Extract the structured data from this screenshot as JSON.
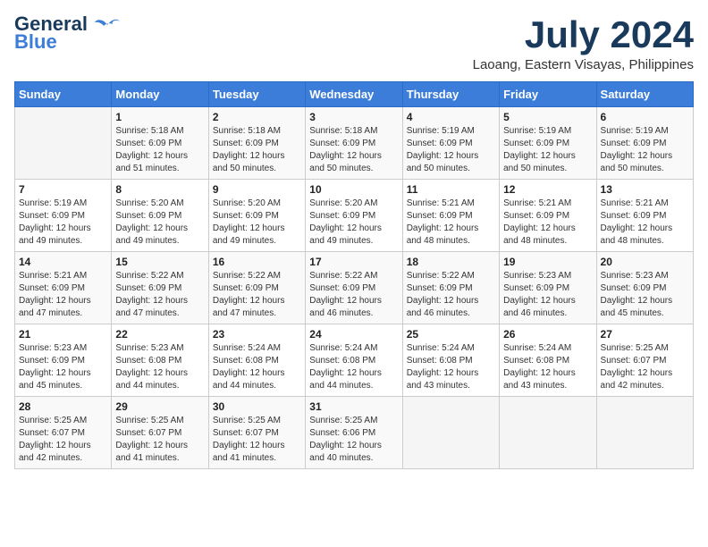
{
  "logo": {
    "line1": "General",
    "line2": "Blue"
  },
  "title": "July 2024",
  "location": "Laoang, Eastern Visayas, Philippines",
  "days_header": [
    "Sunday",
    "Monday",
    "Tuesday",
    "Wednesday",
    "Thursday",
    "Friday",
    "Saturday"
  ],
  "weeks": [
    [
      {
        "day": "",
        "info": ""
      },
      {
        "day": "1",
        "info": "Sunrise: 5:18 AM\nSunset: 6:09 PM\nDaylight: 12 hours\nand 51 minutes."
      },
      {
        "day": "2",
        "info": "Sunrise: 5:18 AM\nSunset: 6:09 PM\nDaylight: 12 hours\nand 50 minutes."
      },
      {
        "day": "3",
        "info": "Sunrise: 5:18 AM\nSunset: 6:09 PM\nDaylight: 12 hours\nand 50 minutes."
      },
      {
        "day": "4",
        "info": "Sunrise: 5:19 AM\nSunset: 6:09 PM\nDaylight: 12 hours\nand 50 minutes."
      },
      {
        "day": "5",
        "info": "Sunrise: 5:19 AM\nSunset: 6:09 PM\nDaylight: 12 hours\nand 50 minutes."
      },
      {
        "day": "6",
        "info": "Sunrise: 5:19 AM\nSunset: 6:09 PM\nDaylight: 12 hours\nand 50 minutes."
      }
    ],
    [
      {
        "day": "7",
        "info": "Sunrise: 5:19 AM\nSunset: 6:09 PM\nDaylight: 12 hours\nand 49 minutes."
      },
      {
        "day": "8",
        "info": "Sunrise: 5:20 AM\nSunset: 6:09 PM\nDaylight: 12 hours\nand 49 minutes."
      },
      {
        "day": "9",
        "info": "Sunrise: 5:20 AM\nSunset: 6:09 PM\nDaylight: 12 hours\nand 49 minutes."
      },
      {
        "day": "10",
        "info": "Sunrise: 5:20 AM\nSunset: 6:09 PM\nDaylight: 12 hours\nand 49 minutes."
      },
      {
        "day": "11",
        "info": "Sunrise: 5:21 AM\nSunset: 6:09 PM\nDaylight: 12 hours\nand 48 minutes."
      },
      {
        "day": "12",
        "info": "Sunrise: 5:21 AM\nSunset: 6:09 PM\nDaylight: 12 hours\nand 48 minutes."
      },
      {
        "day": "13",
        "info": "Sunrise: 5:21 AM\nSunset: 6:09 PM\nDaylight: 12 hours\nand 48 minutes."
      }
    ],
    [
      {
        "day": "14",
        "info": "Sunrise: 5:21 AM\nSunset: 6:09 PM\nDaylight: 12 hours\nand 47 minutes."
      },
      {
        "day": "15",
        "info": "Sunrise: 5:22 AM\nSunset: 6:09 PM\nDaylight: 12 hours\nand 47 minutes."
      },
      {
        "day": "16",
        "info": "Sunrise: 5:22 AM\nSunset: 6:09 PM\nDaylight: 12 hours\nand 47 minutes."
      },
      {
        "day": "17",
        "info": "Sunrise: 5:22 AM\nSunset: 6:09 PM\nDaylight: 12 hours\nand 46 minutes."
      },
      {
        "day": "18",
        "info": "Sunrise: 5:22 AM\nSunset: 6:09 PM\nDaylight: 12 hours\nand 46 minutes."
      },
      {
        "day": "19",
        "info": "Sunrise: 5:23 AM\nSunset: 6:09 PM\nDaylight: 12 hours\nand 46 minutes."
      },
      {
        "day": "20",
        "info": "Sunrise: 5:23 AM\nSunset: 6:09 PM\nDaylight: 12 hours\nand 45 minutes."
      }
    ],
    [
      {
        "day": "21",
        "info": "Sunrise: 5:23 AM\nSunset: 6:09 PM\nDaylight: 12 hours\nand 45 minutes."
      },
      {
        "day": "22",
        "info": "Sunrise: 5:23 AM\nSunset: 6:08 PM\nDaylight: 12 hours\nand 44 minutes."
      },
      {
        "day": "23",
        "info": "Sunrise: 5:24 AM\nSunset: 6:08 PM\nDaylight: 12 hours\nand 44 minutes."
      },
      {
        "day": "24",
        "info": "Sunrise: 5:24 AM\nSunset: 6:08 PM\nDaylight: 12 hours\nand 44 minutes."
      },
      {
        "day": "25",
        "info": "Sunrise: 5:24 AM\nSunset: 6:08 PM\nDaylight: 12 hours\nand 43 minutes."
      },
      {
        "day": "26",
        "info": "Sunrise: 5:24 AM\nSunset: 6:08 PM\nDaylight: 12 hours\nand 43 minutes."
      },
      {
        "day": "27",
        "info": "Sunrise: 5:25 AM\nSunset: 6:07 PM\nDaylight: 12 hours\nand 42 minutes."
      }
    ],
    [
      {
        "day": "28",
        "info": "Sunrise: 5:25 AM\nSunset: 6:07 PM\nDaylight: 12 hours\nand 42 minutes."
      },
      {
        "day": "29",
        "info": "Sunrise: 5:25 AM\nSunset: 6:07 PM\nDaylight: 12 hours\nand 41 minutes."
      },
      {
        "day": "30",
        "info": "Sunrise: 5:25 AM\nSunset: 6:07 PM\nDaylight: 12 hours\nand 41 minutes."
      },
      {
        "day": "31",
        "info": "Sunrise: 5:25 AM\nSunset: 6:06 PM\nDaylight: 12 hours\nand 40 minutes."
      },
      {
        "day": "",
        "info": ""
      },
      {
        "day": "",
        "info": ""
      },
      {
        "day": "",
        "info": ""
      }
    ]
  ]
}
